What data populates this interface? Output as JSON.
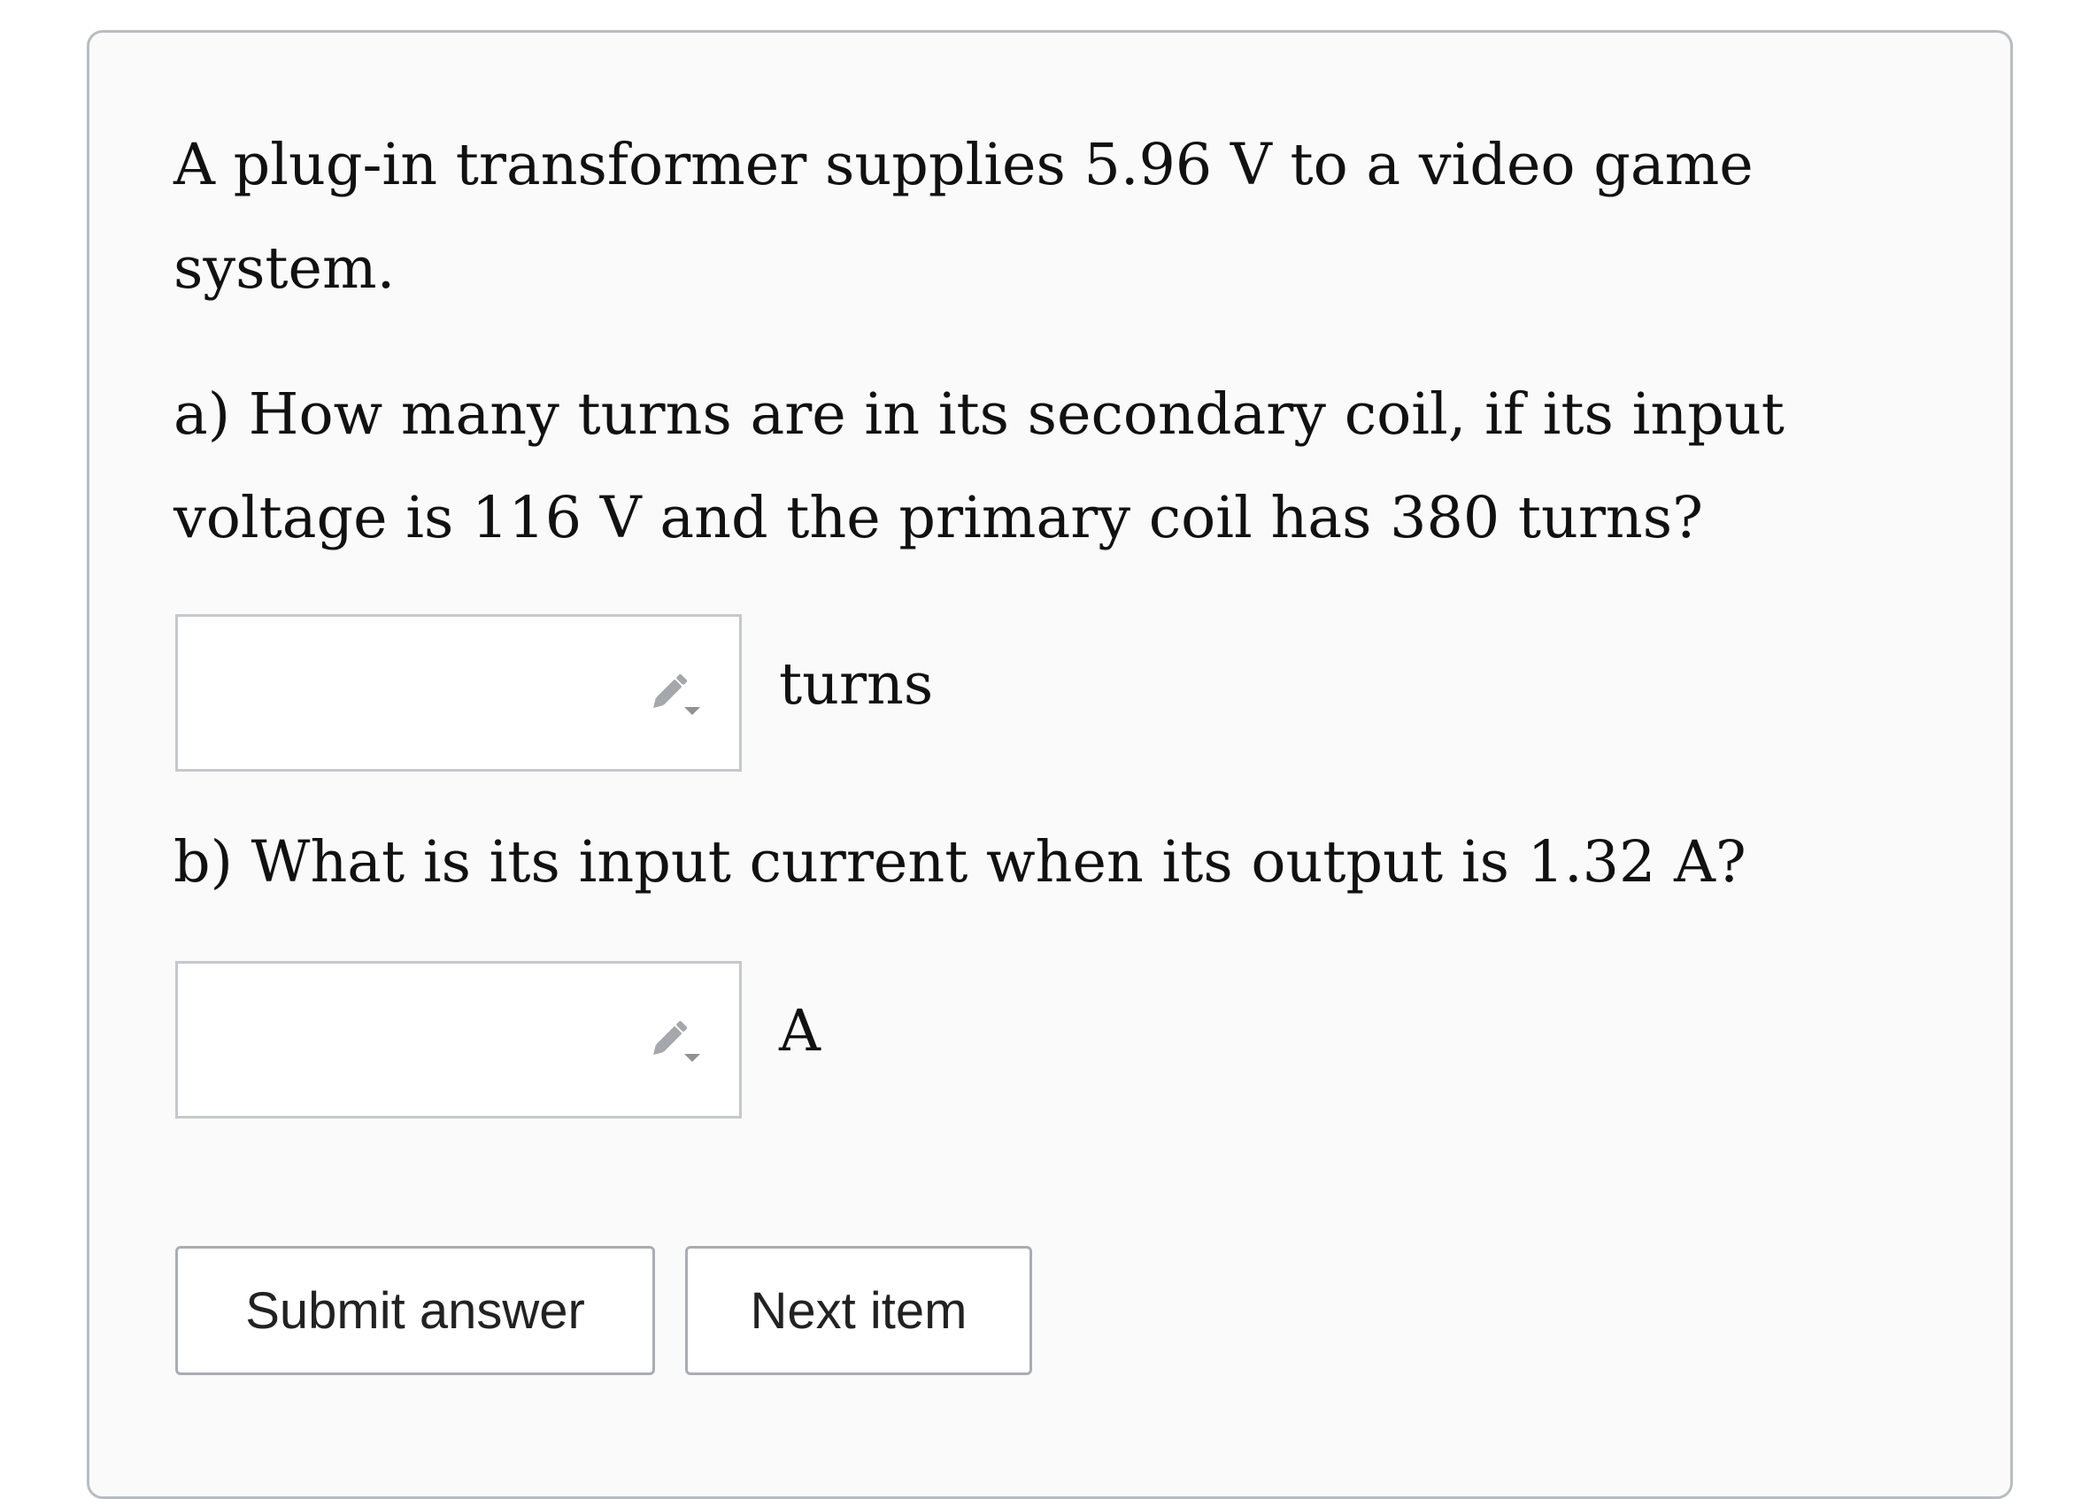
{
  "question": {
    "intro": [
      "A plug-in transformer supplies 5.96 V to a video game",
      "system."
    ],
    "part_a": [
      "a) How many turns are in its secondary coil, if its input",
      "voltage is 116 V and the primary coil has 380 turns?"
    ],
    "part_b": [
      "b) What is its input current when its output is 1.32 A?"
    ]
  },
  "answers": [
    {
      "value": "",
      "unit": "turns",
      "icon": "pencil-dropdown-icon"
    },
    {
      "value": "",
      "unit": "A",
      "icon": "pencil-dropdown-icon"
    }
  ],
  "buttons": {
    "submit_label": "Submit answer",
    "next_label": "Next item"
  }
}
